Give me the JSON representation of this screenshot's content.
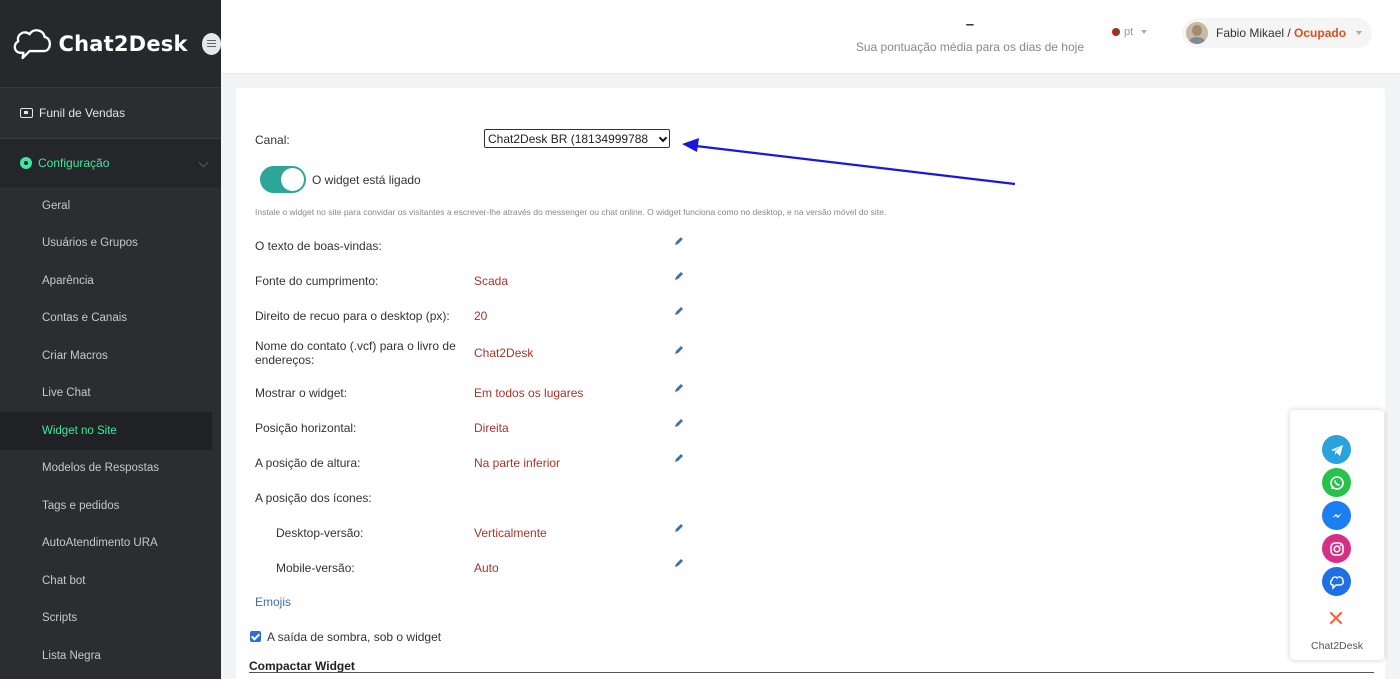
{
  "brand": {
    "name": "Chat2Desk"
  },
  "sidebar": {
    "top_item": "Funil de Vendas",
    "section": "Configuração",
    "items": [
      {
        "label": "Geral"
      },
      {
        "label": "Usuários e Grupos"
      },
      {
        "label": "Aparência"
      },
      {
        "label": "Contas e Canais"
      },
      {
        "label": "Criar Macros"
      },
      {
        "label": "Live Chat"
      },
      {
        "label": "Widget no Site",
        "active": true
      },
      {
        "label": "Modelos de Respostas"
      },
      {
        "label": "Tags e pedidos"
      },
      {
        "label": "AutoAtendimento URA"
      },
      {
        "label": "Chat bot"
      },
      {
        "label": "Scripts"
      },
      {
        "label": "Lista Negra"
      }
    ]
  },
  "header": {
    "score_value": "–",
    "score_text": "Sua pontuação média para os dias de hoje",
    "lang": "pt",
    "user_name": "Fabio Mikael",
    "user_sep": " / ",
    "user_status": "Ocupado"
  },
  "form": {
    "channel_label": "Canal:",
    "channel_value": "Chat2Desk BR (18134999788",
    "toggle_label": "O widget está ligado",
    "hint": "Instale o widget no site para convidar os visitantes a escrever-lhe através do messenger ou chat online. O widget funciona como no desktop, e na versão móvel do site.",
    "welcome_label": "O texto de boas-vindas:",
    "font_label": "Fonte do cumprimento:",
    "font_value": "Scada",
    "offset_label": "Direito de recuo para o desktop (px):",
    "offset_value": "20",
    "vcf_label_1": "Nome do contato (.vcf) para o livro de",
    "vcf_label_2": "endereços:",
    "vcf_value": "Chat2Desk",
    "show_label": "Mostrar o widget:",
    "show_value": "Em todos os lugares",
    "hpos_label": "Posição horizontal:",
    "hpos_value": "Direita",
    "vpos_label": "A posição de altura:",
    "vpos_value": "Na parte inferior",
    "icons_label": "A posição dos ícones:",
    "desktop_label": "Desktop-versão:",
    "desktop_value": "Verticalmente",
    "mobile_label": "Mobile-versão:",
    "mobile_value": "Auto",
    "emojis": "Emojis",
    "shadow_label": "A saída de sombra, sob o widget",
    "compact_label": "Compactar Widget"
  },
  "widget": {
    "name": "Chat2Desk",
    "icons": [
      "telegram-icon",
      "whatsapp-icon",
      "messenger-icon",
      "instagram-icon",
      "chat2desk-icon"
    ]
  },
  "colors": {
    "accent": "#3ee8a0",
    "toggle": "#2da697",
    "value_text": "#a5352a",
    "status": "#e24b1a",
    "arrow": "#1a16e0"
  }
}
